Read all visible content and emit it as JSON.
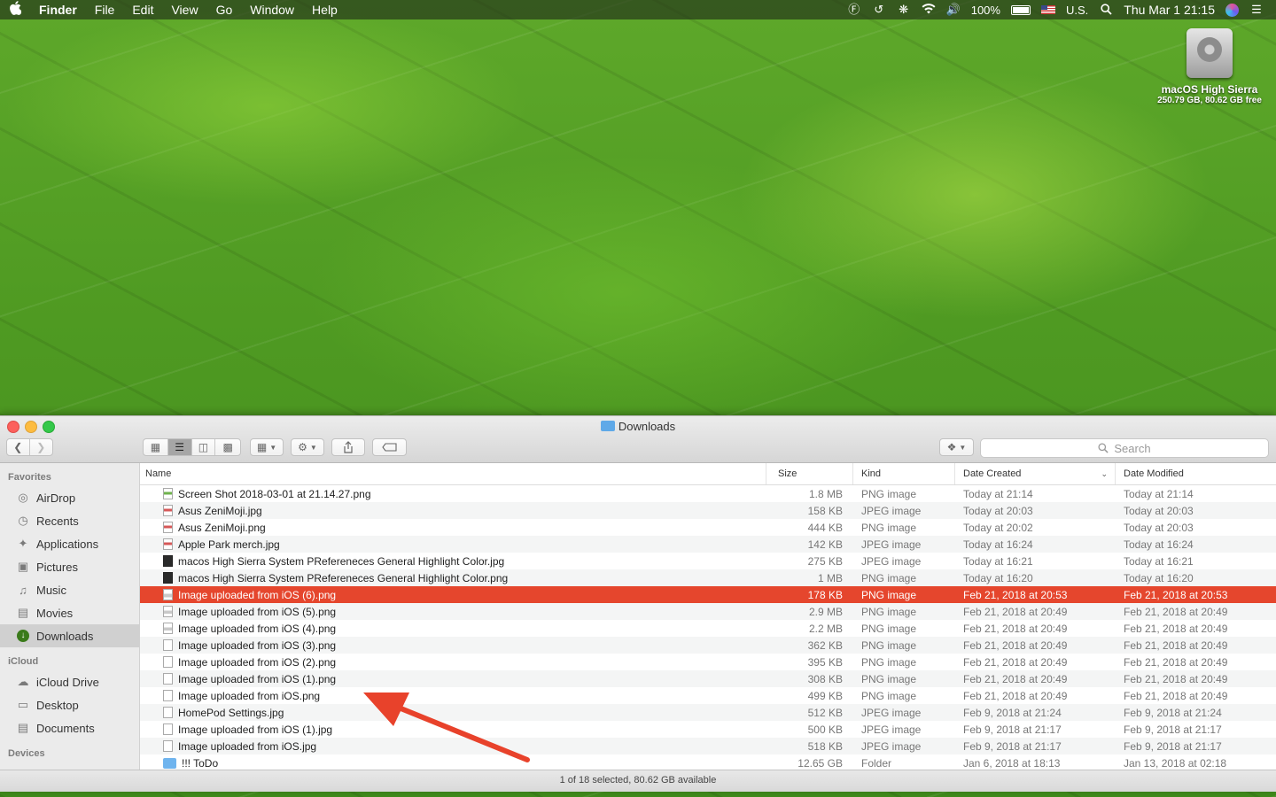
{
  "menubar": {
    "apple": "",
    "app": "Finder",
    "menus": [
      "File",
      "Edit",
      "View",
      "Go",
      "Window",
      "Help"
    ],
    "battery": "100%",
    "input_source": "U.S.",
    "clock": "Thu Mar 1  21:15"
  },
  "desktop": {
    "disk_name": "macOS High Sierra",
    "disk_info": "250.79 GB, 80.62 GB free"
  },
  "window": {
    "title": "Downloads",
    "search_placeholder": "Search",
    "status": "1 of 18 selected, 80.62 GB available"
  },
  "sidebar": {
    "favorites_header": "Favorites",
    "favorites": [
      {
        "label": "AirDrop",
        "icon": "airdrop-icon"
      },
      {
        "label": "Recents",
        "icon": "clock-icon"
      },
      {
        "label": "Applications",
        "icon": "applications-icon"
      },
      {
        "label": "Pictures",
        "icon": "camera-icon"
      },
      {
        "label": "Music",
        "icon": "music-note-icon"
      },
      {
        "label": "Movies",
        "icon": "film-icon"
      },
      {
        "label": "Downloads",
        "icon": "download-icon",
        "selected": true
      }
    ],
    "icloud_header": "iCloud",
    "icloud": [
      {
        "label": "iCloud Drive",
        "icon": "cloud-icon"
      },
      {
        "label": "Desktop",
        "icon": "desktop-icon"
      },
      {
        "label": "Documents",
        "icon": "document-icon"
      }
    ],
    "devices_header": "Devices"
  },
  "columns": {
    "name": "Name",
    "size": "Size",
    "kind": "Kind",
    "created": "Date Created",
    "modified": "Date Modified"
  },
  "files": [
    {
      "name": "Screen Shot 2018-03-01 at 21.14.27.png",
      "size": "1.8 MB",
      "kind": "PNG image",
      "created": "Today at 21:14",
      "modified": "Today at 21:14",
      "icon": "green"
    },
    {
      "name": "Asus ZeniMoji.jpg",
      "size": "158 KB",
      "kind": "JPEG image",
      "created": "Today at 20:03",
      "modified": "Today at 20:03",
      "icon": "jpg"
    },
    {
      "name": "Asus ZeniMoji.png",
      "size": "444 KB",
      "kind": "PNG image",
      "created": "Today at 20:02",
      "modified": "Today at 20:03",
      "icon": "jpg"
    },
    {
      "name": "Apple Park merch.jpg",
      "size": "142 KB",
      "kind": "JPEG image",
      "created": "Today at 16:24",
      "modified": "Today at 16:24",
      "icon": "jpg"
    },
    {
      "name": "macos High Sierra System PRefereneces General Highlight Color.jpg",
      "size": "275 KB",
      "kind": "JPEG image",
      "created": "Today at 16:21",
      "modified": "Today at 16:21",
      "icon": "dark"
    },
    {
      "name": "macos High Sierra System PRefereneces General Highlight Color.png",
      "size": "1 MB",
      "kind": "PNG image",
      "created": "Today at 16:20",
      "modified": "Today at 16:20",
      "icon": "dark"
    },
    {
      "name": "Image uploaded from iOS (6).png",
      "size": "178 KB",
      "kind": "PNG image",
      "created": "Feb 21, 2018 at 20:53",
      "modified": "Feb 21, 2018 at 20:53",
      "icon": "img",
      "selected": true
    },
    {
      "name": "Image uploaded from iOS (5).png",
      "size": "2.9 MB",
      "kind": "PNG image",
      "created": "Feb 21, 2018 at 20:49",
      "modified": "Feb 21, 2018 at 20:49",
      "icon": "img"
    },
    {
      "name": "Image uploaded from iOS (4).png",
      "size": "2.2 MB",
      "kind": "PNG image",
      "created": "Feb 21, 2018 at 20:49",
      "modified": "Feb 21, 2018 at 20:49",
      "icon": "img"
    },
    {
      "name": "Image uploaded from iOS (3).png",
      "size": "362 KB",
      "kind": "PNG image",
      "created": "Feb 21, 2018 at 20:49",
      "modified": "Feb 21, 2018 at 20:49",
      "icon": "plain"
    },
    {
      "name": "Image uploaded from iOS (2).png",
      "size": "395 KB",
      "kind": "PNG image",
      "created": "Feb 21, 2018 at 20:49",
      "modified": "Feb 21, 2018 at 20:49",
      "icon": "plain"
    },
    {
      "name": "Image uploaded from iOS (1).png",
      "size": "308 KB",
      "kind": "PNG image",
      "created": "Feb 21, 2018 at 20:49",
      "modified": "Feb 21, 2018 at 20:49",
      "icon": "plain"
    },
    {
      "name": "Image uploaded from iOS.png",
      "size": "499 KB",
      "kind": "PNG image",
      "created": "Feb 21, 2018 at 20:49",
      "modified": "Feb 21, 2018 at 20:49",
      "icon": "plain"
    },
    {
      "name": "HomePod Settings.jpg",
      "size": "512 KB",
      "kind": "JPEG image",
      "created": "Feb 9, 2018 at 21:24",
      "modified": "Feb 9, 2018 at 21:24",
      "icon": "plain"
    },
    {
      "name": "Image uploaded from iOS (1).jpg",
      "size": "500 KB",
      "kind": "JPEG image",
      "created": "Feb 9, 2018 at 21:17",
      "modified": "Feb 9, 2018 at 21:17",
      "icon": "plain"
    },
    {
      "name": "Image uploaded from iOS.jpg",
      "size": "518 KB",
      "kind": "JPEG image",
      "created": "Feb 9, 2018 at 21:17",
      "modified": "Feb 9, 2018 at 21:17",
      "icon": "plain"
    },
    {
      "name": "!!! ToDo",
      "size": "12.65 GB",
      "kind": "Folder",
      "created": "Jan 6, 2018 at 18:13",
      "modified": "Jan 13, 2018 at 02:18",
      "icon": "folder"
    }
  ],
  "colors": {
    "selection": "#e5462d",
    "arrow": "#e8422b",
    "close": "#fc605c",
    "minimize": "#fdbc40",
    "zoom": "#34c84a"
  }
}
